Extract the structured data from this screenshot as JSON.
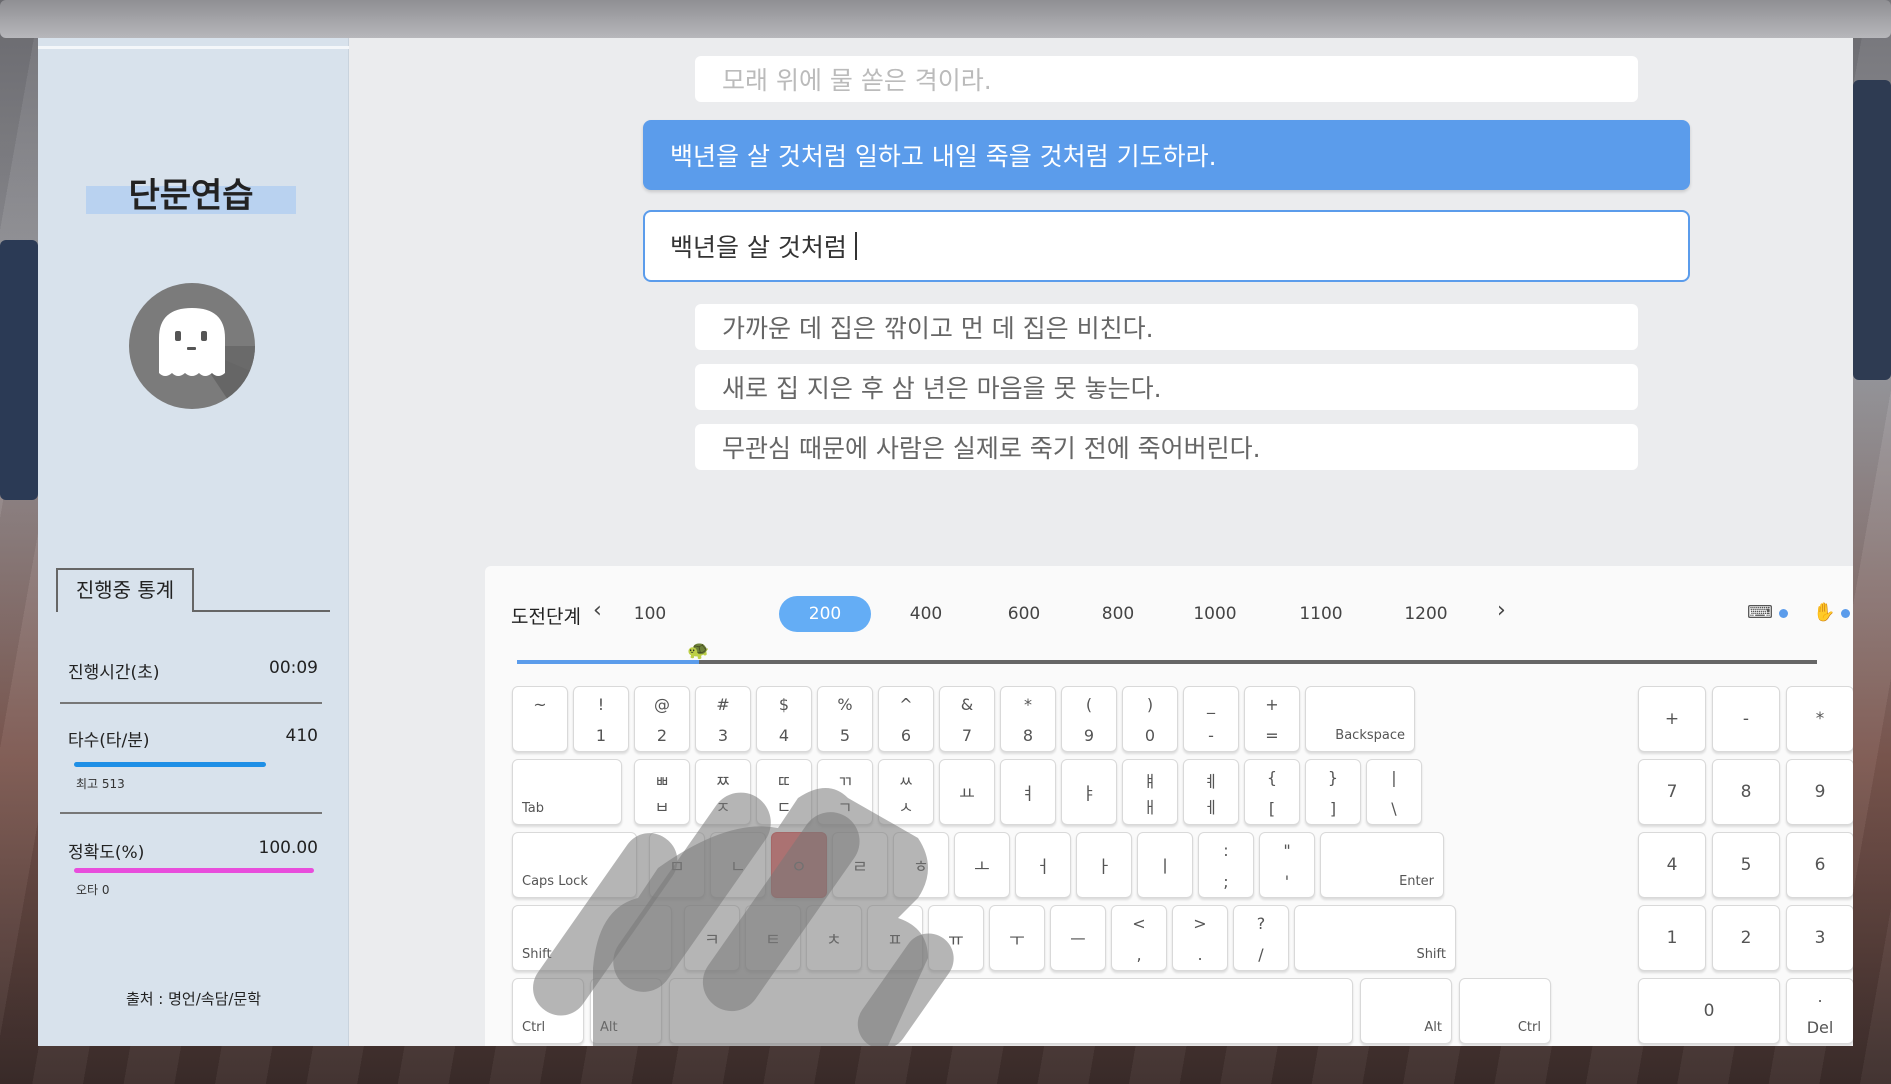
{
  "sidebar": {
    "title": "단문연습",
    "stats_tab": "진행중 통계",
    "elapsed": {
      "label": "진행시간(초)",
      "value": "00:09"
    },
    "speed": {
      "label": "타수(타/분)",
      "value": "410",
      "best": "최고 513",
      "bar_color": "#1e8fe6",
      "level": 0.8
    },
    "accuracy": {
      "label": "정확도(%)",
      "value": "100.00",
      "typos": "오타 0",
      "bar_color": "#e84ddc",
      "level": 1.0
    },
    "source": "출처 : 명언/속담/문학"
  },
  "sentences": {
    "previous": "모래 위에 물 쏟은 격이라.",
    "current": "백년을 살 것처럼 일하고 내일 죽을 것처럼 기도하라.",
    "typed": "백년을 살 것처럼",
    "next": [
      "가까운 데 집은 깎이고 먼 데 집은 비친다.",
      "새로 집 지은 후 삼 년은 마음을 못 놓는다.",
      "무관심 때문에 사람은 실제로 죽기 전에 죽어버린다."
    ]
  },
  "levels": {
    "label": "도전단계",
    "prev_icon": "chevron-left-icon",
    "next_icon": "chevron-right-icon",
    "items": [
      "100",
      "200",
      "400",
      "600",
      "800",
      "1000",
      "1100",
      "1200"
    ],
    "active": "200",
    "progress": 0.14,
    "marker_icon": "turtle-icon",
    "accent": "#5b9ceb"
  },
  "toolbar_icons": [
    "keyboard-icon",
    "hand-icon"
  ],
  "keyboard": {
    "highlight_color": "#e96b6b",
    "highlighted_key": "ㅇ",
    "rows": [
      [
        [
          "~",
          ""
        ],
        [
          "!",
          "1"
        ],
        [
          "@",
          "2"
        ],
        [
          "#",
          "3"
        ],
        [
          "$",
          "4"
        ],
        [
          "%",
          "5"
        ],
        [
          "^",
          "6"
        ],
        [
          "&",
          "7"
        ],
        [
          "*",
          "8"
        ],
        [
          "(",
          "9"
        ],
        [
          ")",
          "0"
        ],
        [
          "_",
          "-"
        ],
        [
          "+",
          "="
        ]
      ],
      [
        [
          "ㅃ",
          "ㅂ"
        ],
        [
          "ㅉ",
          "ㅈ"
        ],
        [
          "ㄸ",
          "ㄷ"
        ],
        [
          "ㄲ",
          "ㄱ"
        ],
        [
          "ㅆ",
          "ㅅ"
        ],
        [
          "ㅛ",
          ""
        ],
        [
          "ㅕ",
          ""
        ],
        [
          "ㅑ",
          ""
        ],
        [
          "ㅒ",
          "ㅐ"
        ],
        [
          "ㅖ",
          "ㅔ"
        ],
        [
          "{",
          "["
        ],
        [
          "}",
          "]"
        ],
        [
          "|",
          "\\"
        ]
      ],
      [
        "ㅁ",
        "ㄴ",
        "ㅇ",
        "ㄹ",
        "ㅎ",
        "ㅗ",
        "ㅓ",
        "ㅏ",
        "ㅣ",
        [
          ":",
          ";"
        ],
        [
          "\"",
          "'"
        ]
      ],
      [
        "ㅋ",
        "ㅌ",
        "ㅊ",
        "ㅍ",
        "ㅠ",
        "ㅜ",
        "ㅡ",
        [
          "<",
          ","
        ],
        [
          ">",
          "."
        ],
        [
          "?",
          "/"
        ]
      ]
    ],
    "backspace": "Backspace",
    "tab": "Tab",
    "caps": "Caps Lock",
    "enter": "Enter",
    "shift": "Shift",
    "ctrl": "Ctrl",
    "alt": "Alt",
    "numpad": {
      "ops": [
        "+",
        "-",
        "*"
      ],
      "row1": [
        "7",
        "8",
        "9"
      ],
      "row2": [
        "4",
        "5",
        "6"
      ],
      "row3": [
        "1",
        "2",
        "3"
      ],
      "zero": "0",
      "del_top": ".",
      "del": "Del"
    }
  }
}
